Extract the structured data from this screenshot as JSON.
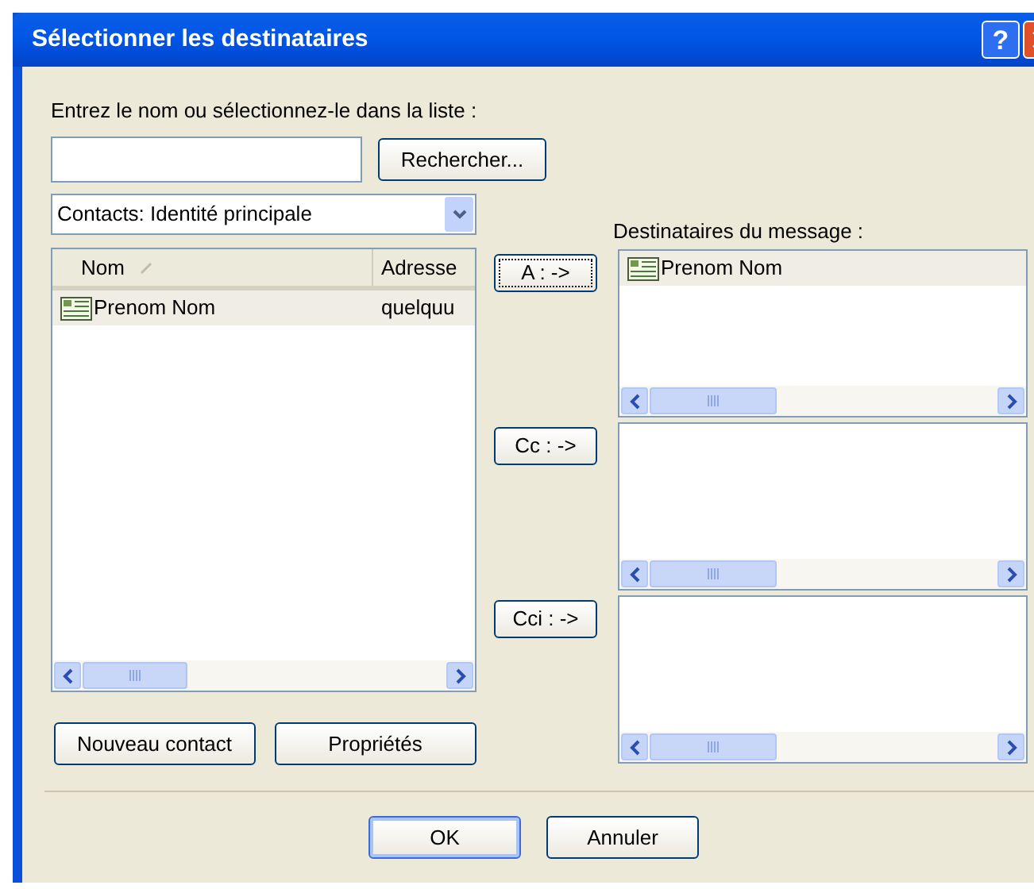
{
  "window": {
    "title": "Sélectionner les destinataires",
    "help_button": "?"
  },
  "instruction": "Entrez le nom ou sélectionnez-le dans la liste :",
  "search_button": "Rechercher...",
  "address_book": {
    "value": "Contacts: Identité principale"
  },
  "contacts": {
    "columns": [
      {
        "label": "Nom",
        "sorted": true
      },
      {
        "label": "Adresse",
        "sorted": false
      }
    ],
    "rows": [
      {
        "name": "Prenom Nom",
        "address": "quelquu",
        "selected": true
      }
    ]
  },
  "contact_buttons": [
    "Nouveau contact",
    "Propriétés"
  ],
  "recipients_label": "Destinataires du message :",
  "recipient_groups": [
    {
      "button": "A : ->",
      "focused": true,
      "entries": [
        {
          "name": "Prenom Nom",
          "selected": true
        }
      ]
    },
    {
      "button": "Cc : ->",
      "focused": false
    },
    {
      "button": "Cci : ->",
      "focused": false
    }
  ],
  "footer_buttons": [
    {
      "label": "OK",
      "default": true
    },
    {
      "label": "Annuler",
      "default": false
    }
  ]
}
